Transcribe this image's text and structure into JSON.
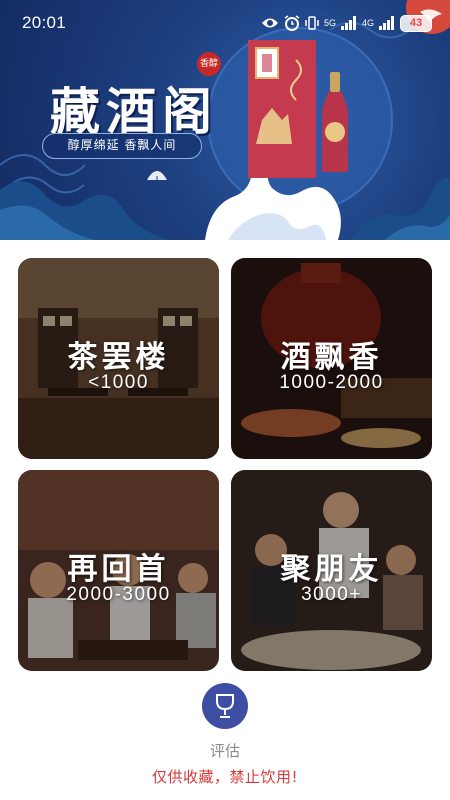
{
  "status_bar": {
    "time": "20:01",
    "network_1": "5G",
    "network_2": "4G",
    "battery": "43",
    "icons": [
      "eye-icon",
      "alarm-icon",
      "vibrate-icon",
      "signal-icon",
      "signal-icon",
      "battery-icon"
    ]
  },
  "banner": {
    "brand_title": "藏酒阁",
    "seal_text": "香醇",
    "slogan": "醇厚绵延 香飘人间",
    "colors": {
      "background": "#1d3f80",
      "wave": "#ffffff",
      "bottle": "#c53a4e"
    }
  },
  "categories": [
    {
      "title": "茶罢楼",
      "range": "<1000"
    },
    {
      "title": "酒飘香",
      "range": "1000-2000"
    },
    {
      "title": "再回首",
      "range": "2000-3000"
    },
    {
      "title": "聚朋友",
      "range": "3000+"
    }
  ],
  "bottom": {
    "eval_icon": "wine-glass-icon",
    "eval_label": "评估",
    "disclaimer": "仅供收藏，禁止饮用!",
    "colors": {
      "eval_button": "#3d4ea3",
      "disclaimer": "#d93a3a"
    }
  }
}
